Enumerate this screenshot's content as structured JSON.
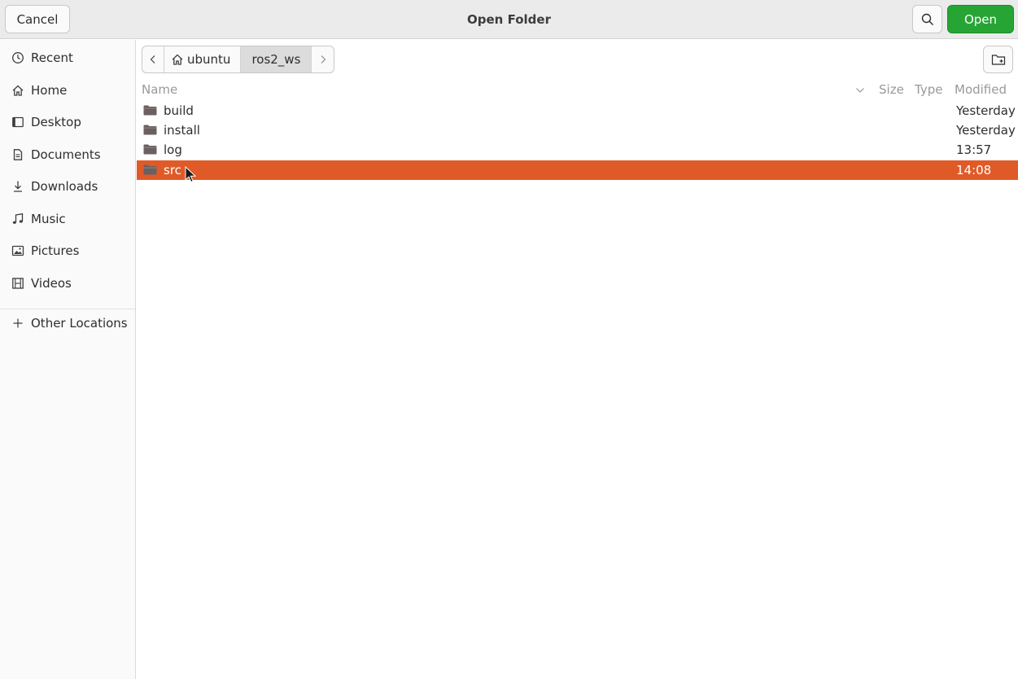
{
  "header": {
    "title": "Open Folder",
    "cancel_label": "Cancel",
    "open_label": "Open"
  },
  "sidebar": {
    "items": [
      {
        "label": "Recent",
        "icon": "clock-icon"
      },
      {
        "label": "Home",
        "icon": "home-icon"
      },
      {
        "label": "Desktop",
        "icon": "desktop-icon"
      },
      {
        "label": "Documents",
        "icon": "document-icon"
      },
      {
        "label": "Downloads",
        "icon": "download-icon"
      },
      {
        "label": "Music",
        "icon": "music-icon"
      },
      {
        "label": "Pictures",
        "icon": "picture-icon"
      },
      {
        "label": "Videos",
        "icon": "video-icon"
      }
    ],
    "other": {
      "label": "Other Locations",
      "icon": "plus-icon"
    }
  },
  "pathbar": {
    "home": "ubuntu",
    "current": "ros2_ws"
  },
  "columns": {
    "name": "Name",
    "size": "Size",
    "type": "Type",
    "modified": "Modified"
  },
  "files": [
    {
      "name": "build",
      "modified": "Yesterday"
    },
    {
      "name": "install",
      "modified": "Yesterday"
    },
    {
      "name": "log",
      "modified": "13:57"
    },
    {
      "name": "src",
      "modified": "14:08",
      "selected": true
    }
  ],
  "colors": {
    "accent_selected": "#e05a28",
    "open_button": "#26a535",
    "folder_icon": "#6b5f5f"
  }
}
